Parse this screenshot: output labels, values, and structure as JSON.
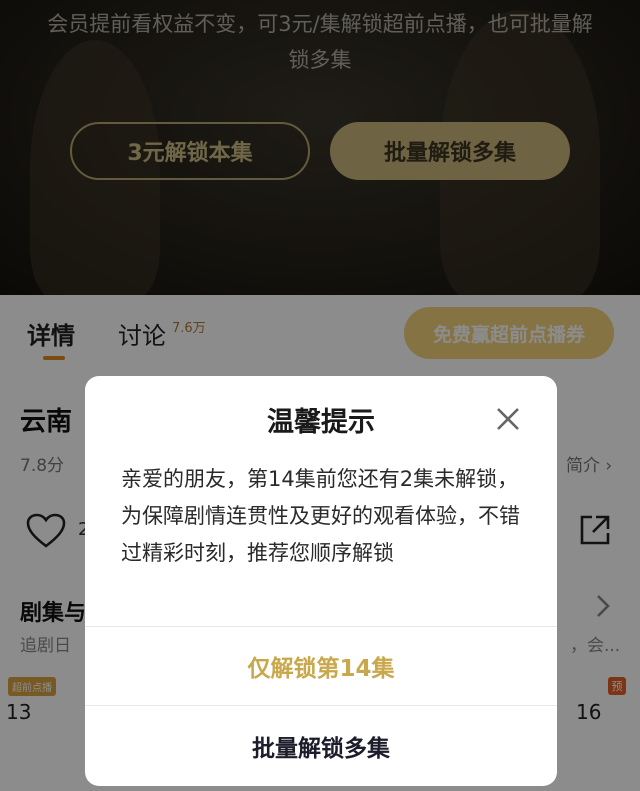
{
  "paywall": {
    "message": "会员提前看权益不变，可3元/集解锁超前点播，也可批量解锁多集",
    "unlock_this_label": "3元解锁本集",
    "batch_unlock_label": "批量解锁多集"
  },
  "tabs": [
    {
      "label": "详情"
    },
    {
      "label": "讨论",
      "count": "7.6万"
    }
  ],
  "promo": {
    "label": "免费赢超前点播券"
  },
  "show": {
    "title": "云南",
    "score": "7.8分",
    "intro_link": "简介 ›",
    "like_count": "2"
  },
  "episodes": {
    "title": "剧集与",
    "subtitle": "追剧日",
    "more": "，会...",
    "items": [
      {
        "number": "13",
        "badge": "超前点播"
      },
      {
        "number": "16",
        "badge": "预"
      }
    ]
  },
  "modal": {
    "title": "温馨提示",
    "body": "亲爱的朋友，第14集前您还有2集未解锁，为保障剧情连贯性及更好的观看体验，不错过精彩时刻，推荐您顺序解锁",
    "single_unlock_label": "仅解锁第14集",
    "batch_unlock_label": "批量解锁多集"
  },
  "colors": {
    "gold": "#c9a84b",
    "gold_button": "#c8b478",
    "accent_orange": "#e08a1c"
  }
}
